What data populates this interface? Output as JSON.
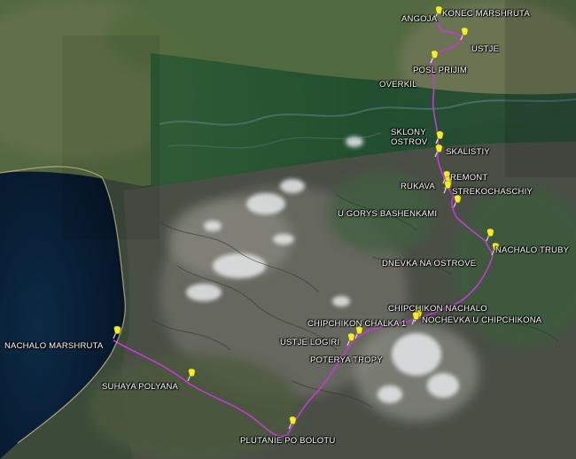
{
  "map": {
    "route_color": "#c23bd4",
    "pin_color": "#f2ee2a",
    "waypoints": [
      {
        "id": "konec",
        "label": "KONEC MARSHRUTA"
      },
      {
        "id": "angoja",
        "label": "ANGOJA"
      },
      {
        "id": "ustje",
        "label": "USTJE"
      },
      {
        "id": "posl-prijim",
        "label": "POSL PRIJIM"
      },
      {
        "id": "overkil",
        "label": "OVERKIL"
      },
      {
        "id": "sklony",
        "label": "SKLONY"
      },
      {
        "id": "ostrov",
        "label": "OSTROV"
      },
      {
        "id": "skalistiy",
        "label": "SKALISTIY"
      },
      {
        "id": "remont",
        "label": "REMONT"
      },
      {
        "id": "rukava",
        "label": "RUKAVA"
      },
      {
        "id": "strekochashchiy",
        "label": "STREKOCHASCHIY"
      },
      {
        "id": "u-gorys",
        "label": "U GORYS BASHENKAMI"
      },
      {
        "id": "nachalo-truby",
        "label": "NACHALO TRUBY"
      },
      {
        "id": "dnevka",
        "label": "DNEVKA NA OSTROVE"
      },
      {
        "id": "chipchikon-nachalo",
        "label": "CHIPCHIKON NACHALO"
      },
      {
        "id": "nochevka",
        "label": "NOCHEVKA U CHIPCHIKONA"
      },
      {
        "id": "chalka",
        "label": "CHIPCHIKON CHALKA 1"
      },
      {
        "id": "ustje-logiri",
        "label": "USTJE LOGIRI"
      },
      {
        "id": "poterya",
        "label": "POTERYA TROPY"
      },
      {
        "id": "nachalo-marshruta",
        "label": "NACHALO MARSHRUTA"
      },
      {
        "id": "suhaya",
        "label": "SUHAYA POLYANA"
      },
      {
        "id": "plutanie",
        "label": "PLUTANIE PO BOLOTU"
      }
    ]
  }
}
